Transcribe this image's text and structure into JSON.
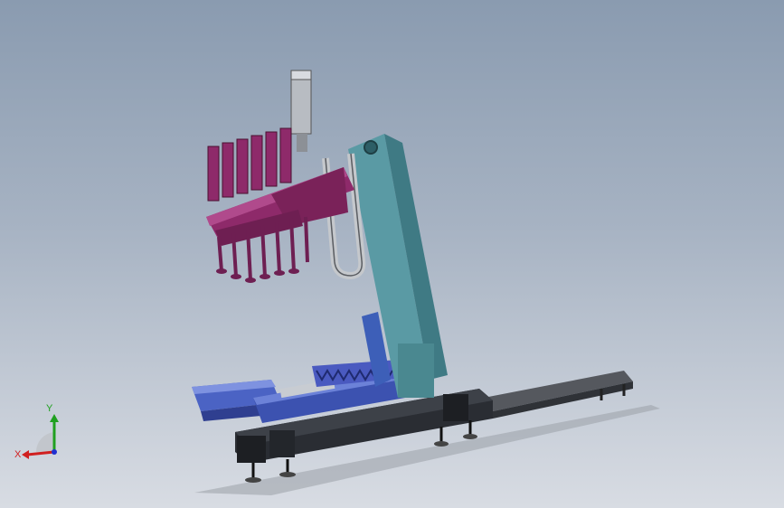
{
  "viewport": {
    "background_top": "#8a9bb0",
    "background_bottom": "#d8dce3"
  },
  "model": {
    "colors": {
      "column": "#5a9aa4",
      "column_dark": "#3f7a84",
      "base_frame": "#2a2d33",
      "slide_table": "#4b63c4",
      "pipette_head": "#8e2a6a",
      "pipette_head_dark": "#6e1f52",
      "steel": "#b8bcc2",
      "rail": "#4a4d52"
    }
  },
  "triad": {
    "x_label": "X",
    "y_label": "Y",
    "x_color": "#d02020",
    "y_color": "#20a020",
    "z_color": "#2030d0"
  }
}
